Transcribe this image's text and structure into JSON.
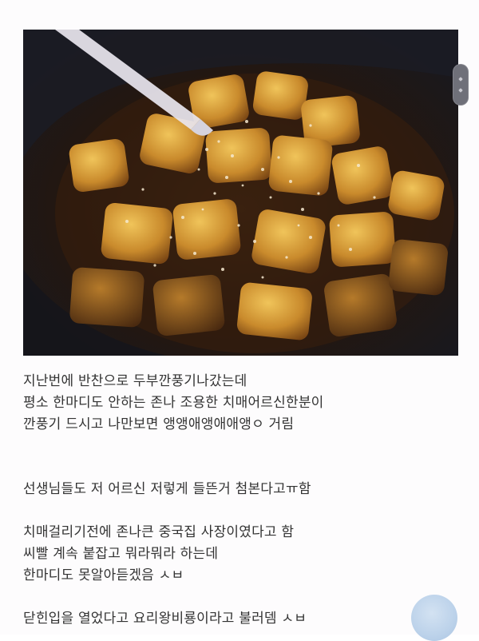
{
  "post": {
    "image_alt": "food-photo",
    "lines": [
      "지난번에 반찬으로 두부깐풍기나갔는데",
      "평소 한마디도 안하는 존나 조용한 치매어르신한분이",
      "깐풍기 드시고 나만보면 앵앵애앵애애앵ㅇ 거림",
      "",
      "",
      "선생님들도 저 어르신 저렇게 들뜬거 첨본다고ㅠ함",
      "",
      "치매걸리기전에 존나큰 중국집 사장이였다고 함",
      "씨빨 계속 붙잡고 뭐라뭐라 하는데",
      "한마디도 못알아듣겠음 ㅅㅂ",
      "",
      "닫힌입을 열었다고 요리왕비룡이라고 불러뎀 ㅅㅂ"
    ]
  },
  "colors": {
    "text": "#333333",
    "fab": "#bcd2ea",
    "scroll_handle": "#6f7079"
  }
}
